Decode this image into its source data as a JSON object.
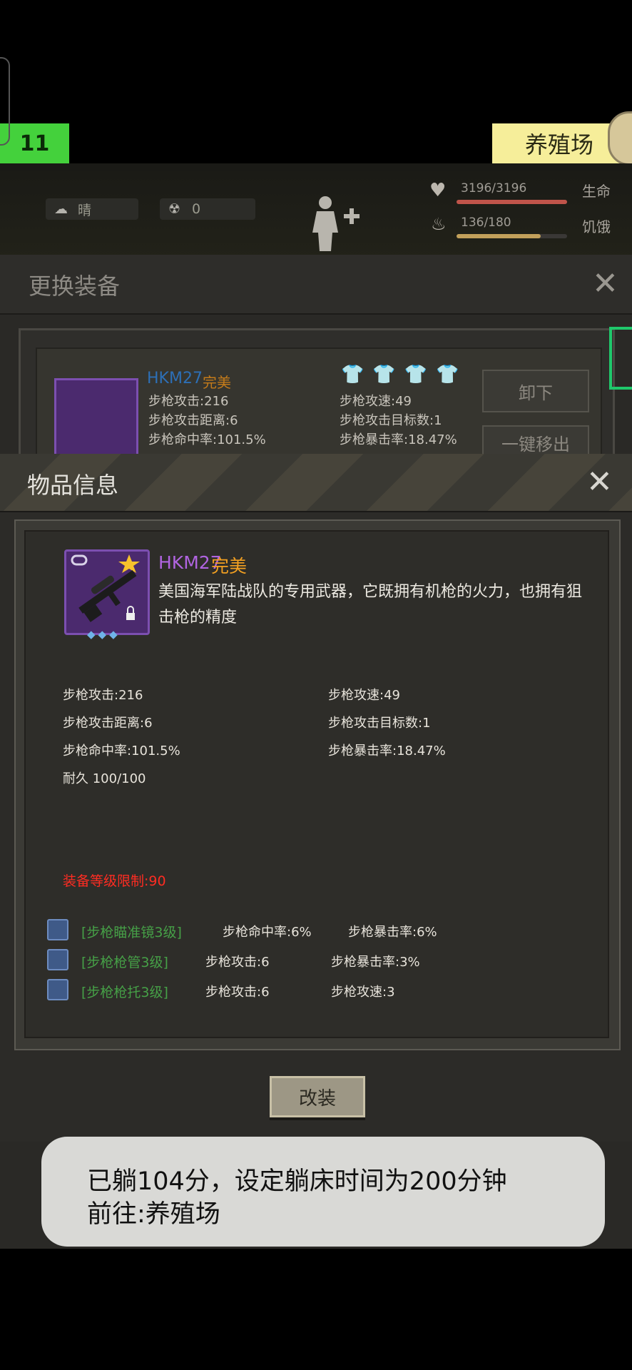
{
  "hud": {
    "day": "11",
    "location": "养殖场",
    "weather": "晴",
    "radiation": "0",
    "health_value": "3196/3196",
    "health_label": "生命",
    "hunger_value": "136/180",
    "hunger_label": "饥饿",
    "health_fraction": 1.0,
    "hunger_fraction": 0.76
  },
  "equip_dialog": {
    "title": "更换装备",
    "item_name": "HKM27",
    "item_grade": "完美",
    "stats": [
      "步枪攻击:216",
      "步枪攻速:49",
      "步枪攻击距离:6",
      "步枪攻击目标数:1",
      "步枪命中率:101.5%",
      "步枪暴击率:18.47%"
    ],
    "unequip_label": "卸下",
    "move_out_label": "一键移出"
  },
  "info_dialog": {
    "title": "物品信息",
    "item_name": "HKM27",
    "item_grade": "完美",
    "description": "美国海军陆战队的专用武器，它既拥有机枪的火力，也拥有狙击枪的精度",
    "stats_left": [
      "步枪攻击:216",
      "步枪攻击距离:6",
      "步枪命中率:101.5%",
      "耐久 100/100"
    ],
    "stats_right": [
      "步枪攻速:49",
      "步枪攻击目标数:1",
      "步枪暴击率:18.47%"
    ],
    "level_requirement": "装备等级限制:90",
    "mods": [
      {
        "name": "[步枪瞄准镜3级]",
        "stat1": "步枪命中率:6%",
        "stat2": "步枪暴击率:6%"
      },
      {
        "name": "[步枪枪管3级]",
        "stat1": "步枪攻击:6",
        "stat2": "步枪暴击率:3%"
      },
      {
        "name": "[步枪枪托3级]",
        "stat1": "步枪攻击:6",
        "stat2": "步枪攻速:3"
      }
    ],
    "refit_label": "改装"
  },
  "toast": {
    "line1": "已躺104分，设定躺床时间为200分钟",
    "line2": "前往:养殖场"
  },
  "colors": {
    "grade": "#f3a021",
    "item_name": "#b064e0",
    "requirement": "#ff2c22",
    "mod_name": "#46a047",
    "health_bar": "#c0544a",
    "hunger_bar": "#c2a05a"
  }
}
